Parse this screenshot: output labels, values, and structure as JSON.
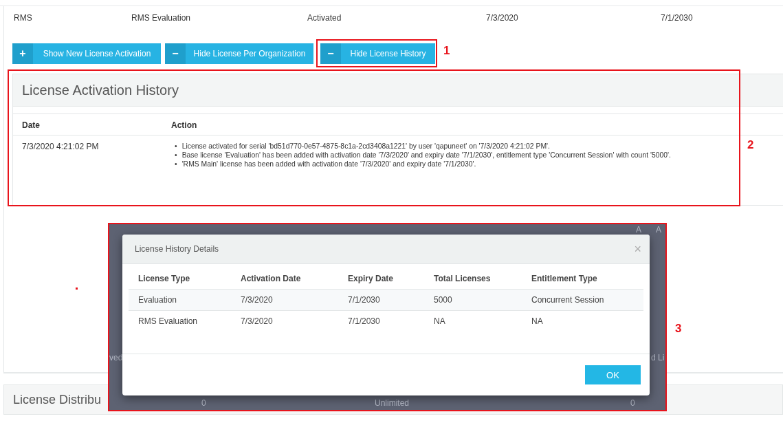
{
  "license_row": [
    "RMS",
    "RMS Evaluation",
    "Activated",
    "7/3/2020",
    "7/1/2030"
  ],
  "buttons": [
    {
      "icon": "+",
      "label": "Show New License Activation"
    },
    {
      "icon": "−",
      "label": "Hide License Per Organization"
    },
    {
      "icon": "−",
      "label": "Hide License History"
    }
  ],
  "history": {
    "title": "License Activation History",
    "columns": [
      "Date",
      "Action"
    ],
    "bullet": "•",
    "rows": [
      {
        "date": "7/3/2020 4:21:02 PM",
        "actions": [
          "License activated for serial 'bd51d770-0e57-4875-8c1a-2cd3408a1221' by user 'qapuneet' on '7/3/2020 4:21:02 PM'.",
          "Base license 'Evaluation' has been added with activation date '7/3/2020' and expiry date '7/1/2030', entitlement type 'Concurrent Session' with count '5000'.",
          "'RMS Main' license has been added with activation date '7/3/2020' and expiry date '7/1/2030'."
        ]
      }
    ]
  },
  "distribution_title": "License Distribu",
  "backdrop_texts": [
    "A",
    "A",
    "ved",
    "d Li",
    "0",
    "Unlimited",
    "0"
  ],
  "dialog": {
    "title": "License History Details",
    "close": "×",
    "columns": [
      "License Type",
      "Activation Date",
      "Expiry Date",
      "Total Licenses",
      "Entitlement Type"
    ],
    "rows": [
      [
        "Evaluation",
        "7/3/2020",
        "7/1/2030",
        "5000",
        "Concurrent Session"
      ],
      [
        "RMS Evaluation",
        "7/3/2020",
        "7/1/2030",
        "NA",
        "NA"
      ]
    ],
    "ok": "OK"
  },
  "annotations": [
    "1",
    "2",
    "3"
  ]
}
